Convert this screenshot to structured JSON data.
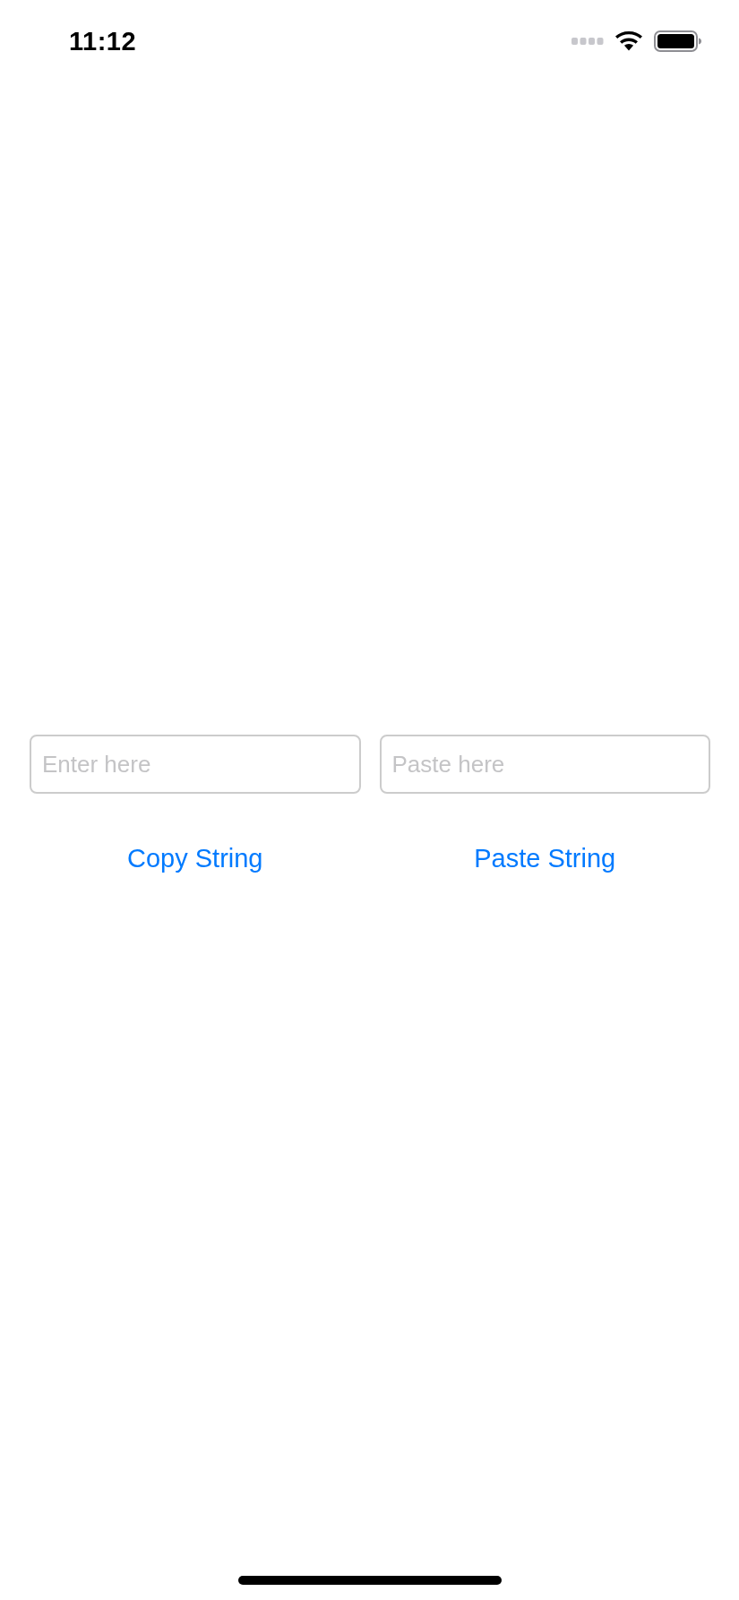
{
  "status_bar": {
    "time": "11:12"
  },
  "fields": [
    {
      "placeholder": "Enter here"
    },
    {
      "placeholder": "Paste here"
    }
  ],
  "buttons": [
    {
      "label": "Copy String"
    },
    {
      "label": "Paste String"
    }
  ]
}
